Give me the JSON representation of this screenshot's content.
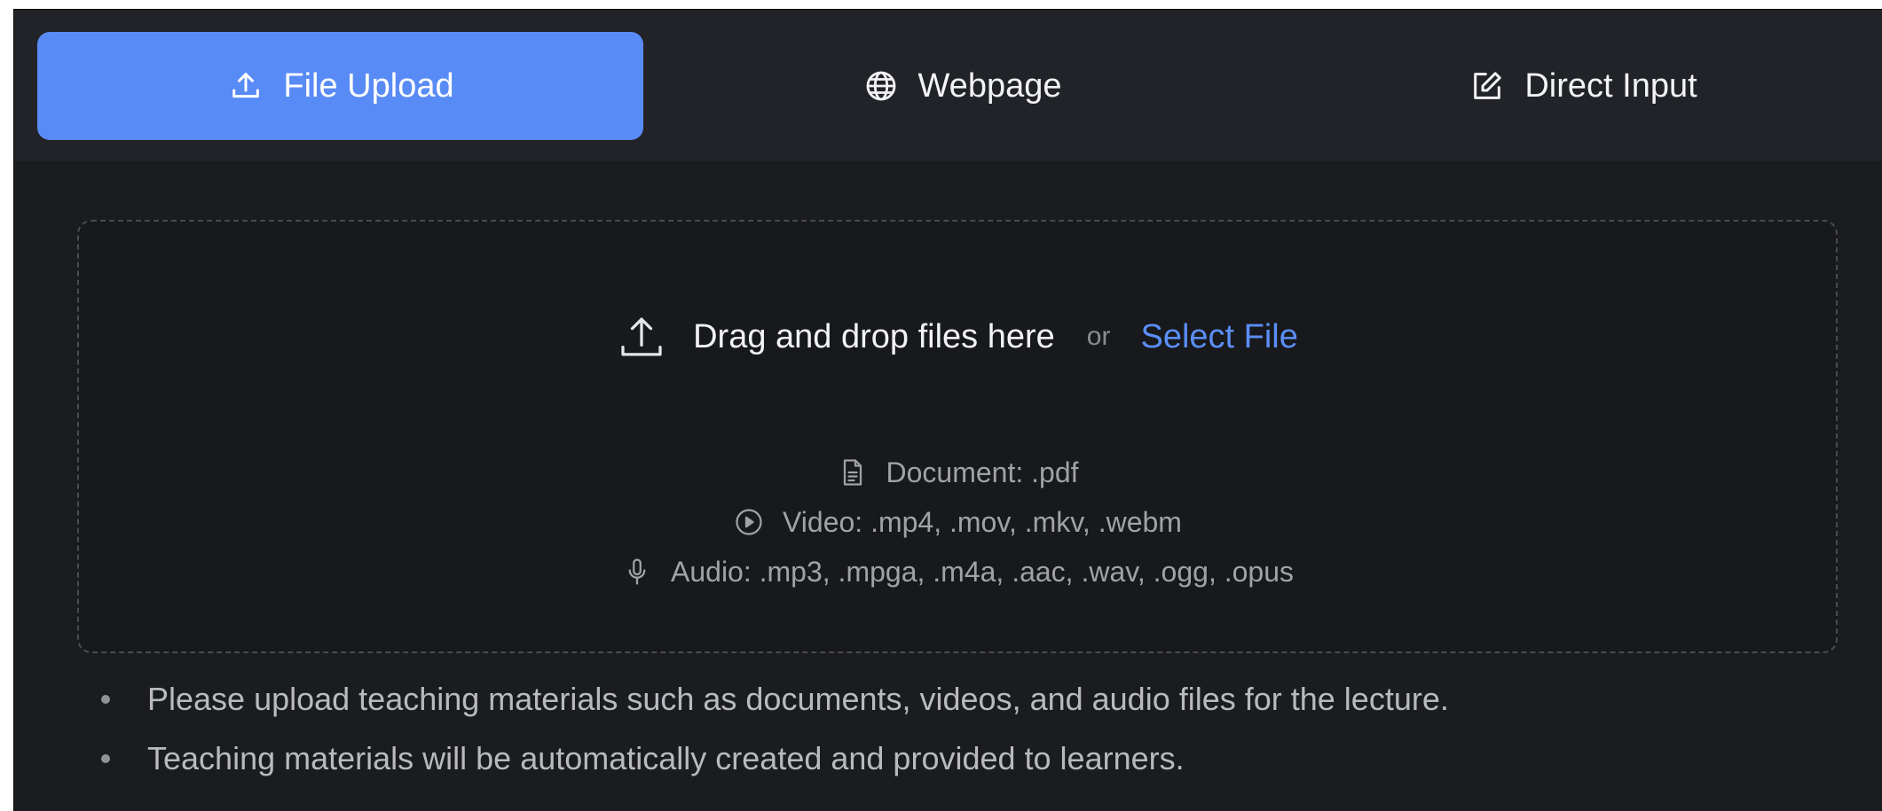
{
  "tabs": [
    {
      "label": "File Upload",
      "icon": "upload-icon",
      "active": true
    },
    {
      "label": "Webpage",
      "icon": "globe-icon",
      "active": false
    },
    {
      "label": "Direct Input",
      "icon": "edit-icon",
      "active": false
    }
  ],
  "dropzone": {
    "drag_text": "Drag and drop files here",
    "or_text": "or",
    "select_label": "Select File",
    "formats": [
      {
        "icon": "document-icon",
        "text": "Document: .pdf"
      },
      {
        "icon": "video-icon",
        "text": "Video: .mp4, .mov, .mkv, .webm"
      },
      {
        "icon": "microphone-icon",
        "text": "Audio: .mp3, .mpga, .m4a, .aac, .wav, .ogg, .opus"
      }
    ]
  },
  "notes": [
    "Please upload teaching materials such as documents, videos, and audio files for the lecture.",
    "Teaching materials will be automatically created and provided to learners."
  ],
  "colors": {
    "accent": "#598bf6",
    "link": "#5b8ef7",
    "background": "#1b1c20",
    "tabbar": "#222328"
  }
}
